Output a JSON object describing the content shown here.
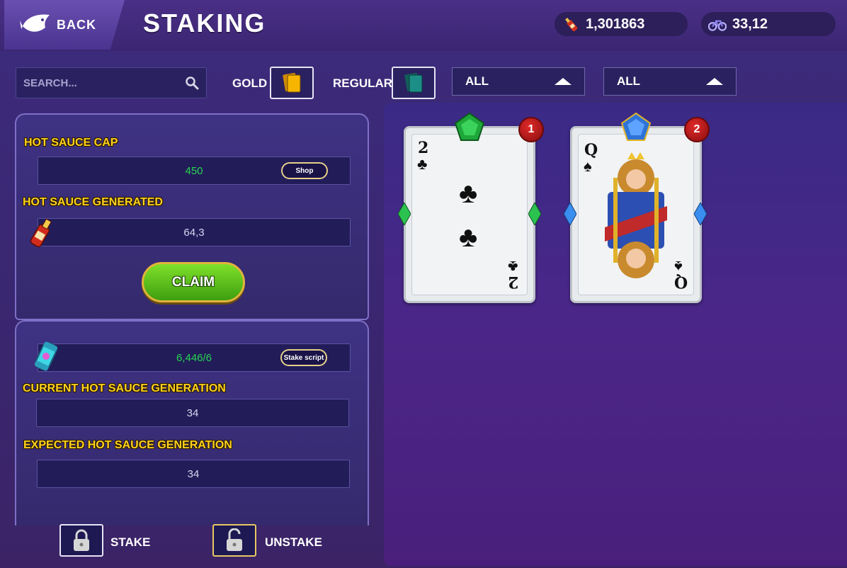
{
  "header": {
    "back_label": "BACK",
    "title": "STAKING",
    "currency_1": {
      "value": "1,301863",
      "icon": "hot-sauce-bottle-icon"
    },
    "currency_2": {
      "value": "33,12",
      "icon": "bike-icon"
    }
  },
  "filters": {
    "search_placeholder": "SEARCH...",
    "gold_label": "GOLD",
    "regular_label": "REGULAR",
    "dropdown_1": "ALL",
    "dropdown_2": "ALL"
  },
  "panel_top": {
    "cap_label": "HOT SAUCE CAP",
    "cap_value": "450",
    "shop_label": "Shop",
    "generated_label": "HOT SAUCE GENERATED",
    "generated_value": "64,3",
    "claim_label": "CLAIM"
  },
  "panel_bottom": {
    "script_value": "6,446/6",
    "stake_script_label": "Stake script",
    "current_label": "CURRENT HOT SAUCE GENERATION",
    "current_value": "34",
    "expected_label": "EXPECTED HOT SAUCE GENERATION",
    "expected_value": "34"
  },
  "actions": {
    "stake_label": "STAKE",
    "unstake_label": "UNSTAKE"
  },
  "cards": [
    {
      "rank": "2",
      "suit": "♣",
      "badge": "1",
      "gem": "emerald",
      "gem_color": "#1fa83a"
    },
    {
      "rank": "Q",
      "suit": "♠",
      "badge": "2",
      "gem": "sapphire",
      "gem_color": "#2e74d8"
    }
  ]
}
